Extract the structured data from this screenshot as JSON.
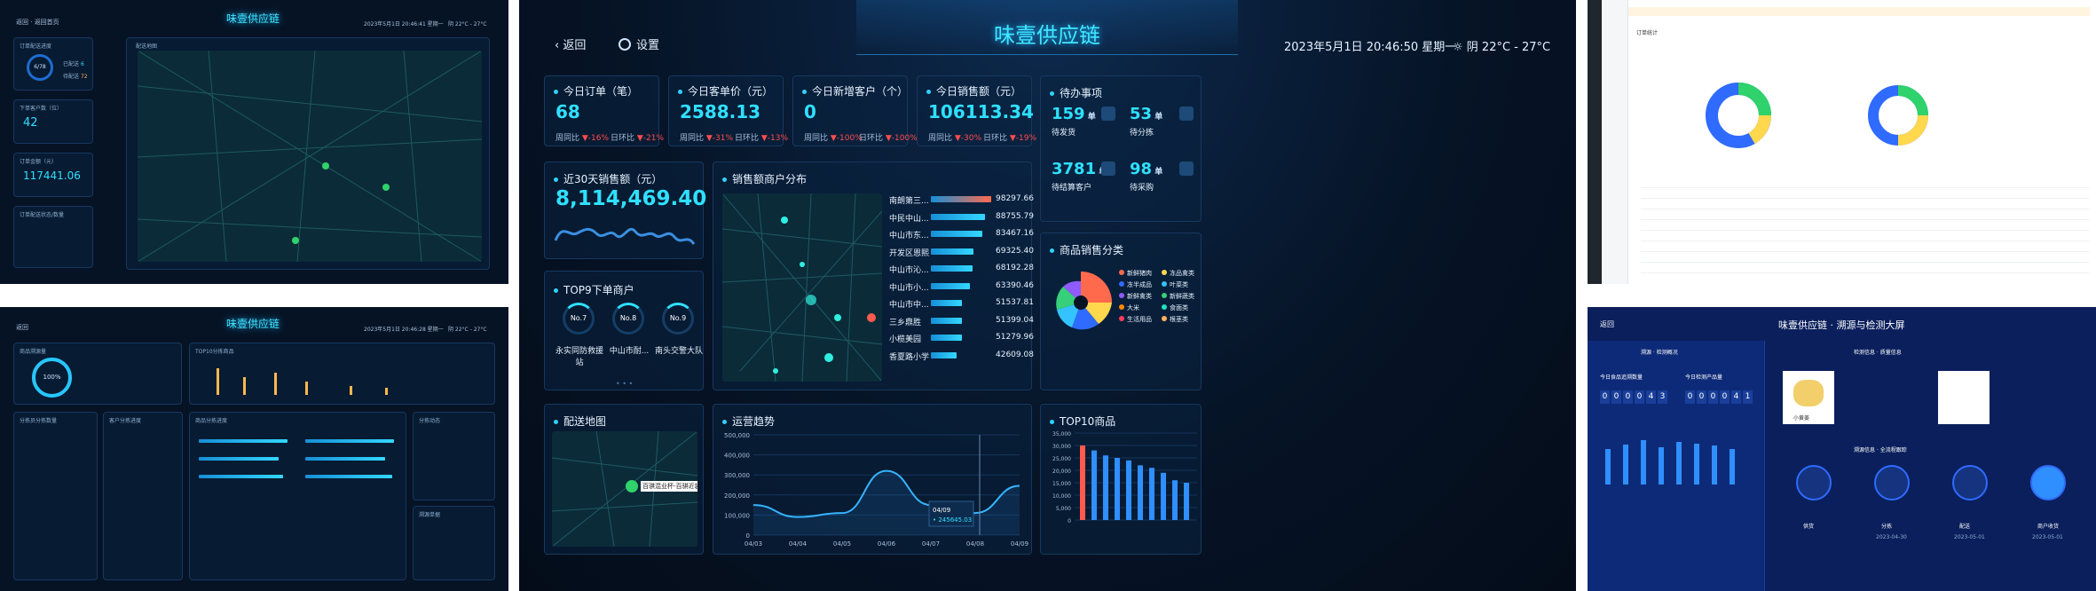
{
  "main": {
    "title": "味壹供应链",
    "back": "返回",
    "settings": "设置",
    "datetime": "2023年5月1日  20:46:50  星期一",
    "weather": "阴  22°C - 27°C",
    "kpis": [
      {
        "label": "今日订单（笔）",
        "value": "68",
        "wow": "周同比",
        "wow_val": "-16%",
        "dod": "日环比",
        "dod_val": "-21%"
      },
      {
        "label": "今日客单价（元）",
        "value": "2588.13",
        "wow": "周同比",
        "wow_val": "-31%",
        "dod": "日环比",
        "dod_val": "-13%"
      },
      {
        "label": "今日新增客户（个）",
        "value": "0",
        "wow": "周同比",
        "wow_val": "-100%",
        "dod": "日环比",
        "dod_val": "-100%"
      },
      {
        "label": "今日销售额（元）",
        "value": "106113.34",
        "wow": "周同比",
        "wow_val": "-30%",
        "dod": "日环比",
        "dod_val": "-19%"
      }
    ],
    "sales30_label": "近30天销售额（元）",
    "sales30_value": "8,114,469.40",
    "top9_title": "TOP9下单商户",
    "top9": [
      {
        "rank": "No.7",
        "name": "永实同防救援站"
      },
      {
        "rank": "No.8",
        "name": "中山市耐..."
      },
      {
        "rank": "No.9",
        "name": "南头交警大队"
      }
    ],
    "dist_title": "销售额商户分布",
    "dist": [
      {
        "name": "南朗第三...",
        "value": "98297.66",
        "pct": 1.0
      },
      {
        "name": "中民中山...",
        "value": "88755.79",
        "pct": 0.9
      },
      {
        "name": "中山市东...",
        "value": "83467.16",
        "pct": 0.85
      },
      {
        "name": "开发区恩熙",
        "value": "69325.40",
        "pct": 0.71
      },
      {
        "name": "中山市沁...",
        "value": "68192.28",
        "pct": 0.69
      },
      {
        "name": "中山市小...",
        "value": "63390.46",
        "pct": 0.64
      },
      {
        "name": "中山市中...",
        "value": "51537.81",
        "pct": 0.52
      },
      {
        "name": "三乡鼎胜",
        "value": "51399.04",
        "pct": 0.52
      },
      {
        "name": "小榄美园",
        "value": "51279.96",
        "pct": 0.52
      },
      {
        "name": "香夏路小学",
        "value": "42609.08",
        "pct": 0.43
      }
    ],
    "todo_title": "待办事项",
    "todo": [
      {
        "value": "159",
        "unit": "单",
        "label": "待发货"
      },
      {
        "value": "53",
        "unit": "单",
        "label": "待分拣"
      },
      {
        "value": "3781",
        "unit": "单",
        "label": "待结算客户"
      },
      {
        "value": "98",
        "unit": "单",
        "label": "待采购"
      }
    ],
    "cat_title": "商品销售分类",
    "categories": [
      {
        "name": "新鲜猪肉",
        "color": "#ff6a4d"
      },
      {
        "name": "冻品禽类",
        "color": "#ffd84d"
      },
      {
        "name": "冻半成品",
        "color": "#2f6bff"
      },
      {
        "name": "叶菜类",
        "color": "#34c3ff"
      },
      {
        "name": "新鲜禽类",
        "color": "#8f5bff"
      },
      {
        "name": "新鲜蔬类",
        "color": "#36d07a"
      },
      {
        "name": "大米",
        "color": "#ff8a00"
      },
      {
        "name": "食面类",
        "color": "#20e0c0"
      },
      {
        "name": "生活用品",
        "color": "#ff3b5c"
      },
      {
        "name": "根茎类",
        "color": "#ffb35c"
      }
    ],
    "delivery_title": "配送地图",
    "delivery_label": "百骐混业杯-百骐近装-黄沙",
    "trend_title": "运营趋势",
    "trend_tip_date": "04/09",
    "trend_tip_val": "• 245645.03",
    "top10_title": "TOP10商品",
    "top10_yticks": [
      "35,000",
      "30,000",
      "25,000",
      "20,000",
      "15,000",
      "10,000",
      "5,000",
      "0"
    ]
  },
  "chart_data": {
    "type": "line",
    "title": "运营趋势",
    "x": [
      "04/03",
      "04/04",
      "04/05",
      "04/06",
      "04/07",
      "04/08",
      "04/09"
    ],
    "y": [
      150000,
      90000,
      110000,
      320000,
      150000,
      110000,
      245645.03
    ],
    "ylim": [
      0,
      500000
    ],
    "yticks": [
      "500,000",
      "400,000",
      "300,000",
      "200,000",
      "100,000",
      "0"
    ],
    "top10": [
      30000,
      28000,
      26000,
      25000,
      24000,
      22000,
      21000,
      19000,
      16000,
      15000
    ]
  },
  "tl": {
    "back": "返回",
    "home": "返回首页",
    "title": "味壹供应链",
    "time": "2023年5月1日  20:46:41  星期一",
    "weather": "阴 22°C - 27°C",
    "p1": "订单配送进度",
    "p1v": "6/78",
    "p1a": "已配送",
    "p1av": "6",
    "p1b": "待配送",
    "p1bv": "72",
    "p2": "下单客户数（位）",
    "p2v": "42",
    "p3": "订单金额（元）",
    "p3v": "117441.06",
    "p4": "订单配送状态/数量",
    "map": "配送地图"
  },
  "bl": {
    "back": "返回",
    "title": "味壹供应链",
    "time": "2023年5月1日 20:46:28 星期一",
    "weather": "阴 22°C - 27°C",
    "p1": "商品溯源量",
    "p1v": "100%",
    "p2": "TOP10分拣商品",
    "p3": "分拣员分拣数量",
    "p4": "客户分拣进度",
    "p5": "商品分拣进度",
    "p6": "分拣动态",
    "p7": "溯源单据"
  },
  "tr": {
    "title": "订单统计"
  },
  "br": {
    "back": "返回",
    "title": "味壹供应链 · 溯源与检测大屏",
    "s1": "溯源 · 检测概况",
    "s2": "检测信息 · 质量信息",
    "s3": "溯源信息 · 全流程跟踪",
    "k1": "今日食品追溯数量",
    "k1v": [
      "0",
      "0",
      "0",
      "0",
      "4",
      "3"
    ],
    "k2": "今日检测产品量",
    "k2v": [
      "0",
      "0",
      "0",
      "0",
      "4",
      "1"
    ],
    "steps": [
      {
        "name": "供货",
        "date": ""
      },
      {
        "name": "分拣",
        "date": "2023-04-30"
      },
      {
        "name": "配送",
        "date": "2023-05-01"
      },
      {
        "name": "商户收货",
        "date": "2023-05-01"
      }
    ],
    "prod": "小黄姜"
  }
}
